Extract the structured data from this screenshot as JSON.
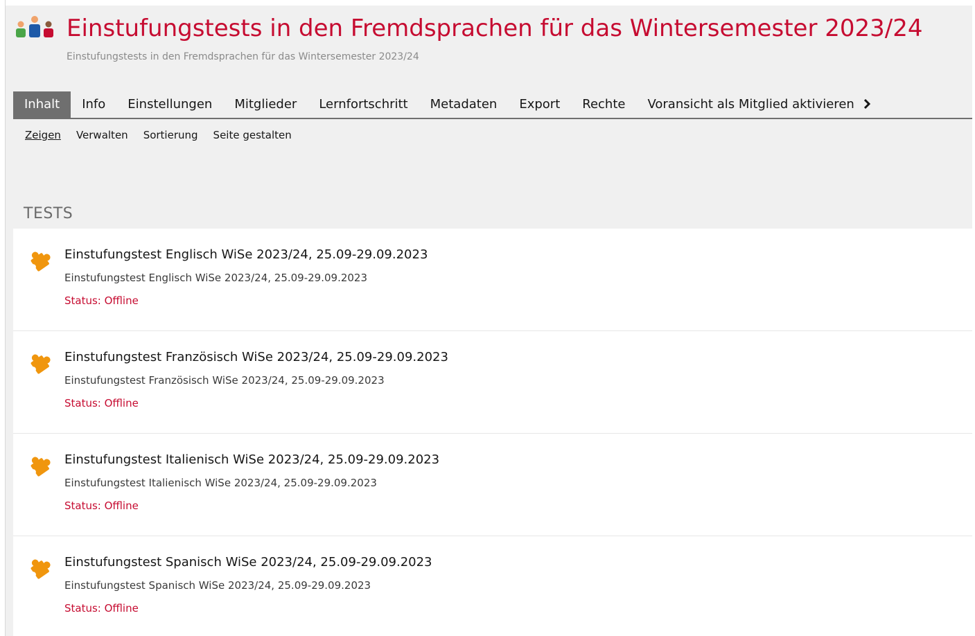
{
  "header": {
    "title": "Einstufungstests in den Fremdsprachen für das Wintersemester 2023/24",
    "subtitle": "Einstufungstests in den Fremdsprachen für das Wintersemester 2023/24",
    "icon": "group-icon",
    "title_color": "#c60c31"
  },
  "tabs": [
    {
      "label": "Inhalt",
      "active": true
    },
    {
      "label": "Info"
    },
    {
      "label": "Einstellungen"
    },
    {
      "label": "Mitglieder"
    },
    {
      "label": "Lernfortschritt"
    },
    {
      "label": "Metadaten"
    },
    {
      "label": "Export"
    },
    {
      "label": "Rechte"
    },
    {
      "label": "Voransicht als Mitglied aktivieren",
      "icon": "chevron-right-icon"
    }
  ],
  "subtabs": [
    {
      "label": "Zeigen",
      "active": true
    },
    {
      "label": "Verwalten"
    },
    {
      "label": "Sortierung"
    },
    {
      "label": "Seite gestalten"
    }
  ],
  "section": {
    "title": "TESTS"
  },
  "items": [
    {
      "title": "Einstufungstest Englisch WiSe 2023/24, 25.09-29.09.2023",
      "description": "Einstufungstest Englisch WiSe 2023/24, 25.09-29.09.2023",
      "status": "Status: Offline",
      "icon": "puzzle-icon"
    },
    {
      "title": "Einstufungstest Französisch WiSe 2023/24, 25.09-29.09.2023",
      "description": "Einstufungstest Französisch WiSe 2023/24, 25.09-29.09.2023",
      "status": "Status: Offline",
      "icon": "puzzle-icon"
    },
    {
      "title": "Einstufungstest Italienisch WiSe 2023/24, 25.09-29.09.2023",
      "description": "Einstufungstest Italienisch WiSe 2023/24, 25.09-29.09.2023",
      "status": "Status: Offline",
      "icon": "puzzle-icon"
    },
    {
      "title": "Einstufungstest Spanisch WiSe 2023/24, 25.09-29.09.2023",
      "description": "Einstufungstest Spanisch WiSe 2023/24, 25.09-29.09.2023",
      "status": "Status: Offline",
      "icon": "puzzle-icon"
    }
  ],
  "colors": {
    "accent": "#c60c31",
    "active_tab": "#6f6f6f",
    "puzzle": "#f0960e"
  }
}
